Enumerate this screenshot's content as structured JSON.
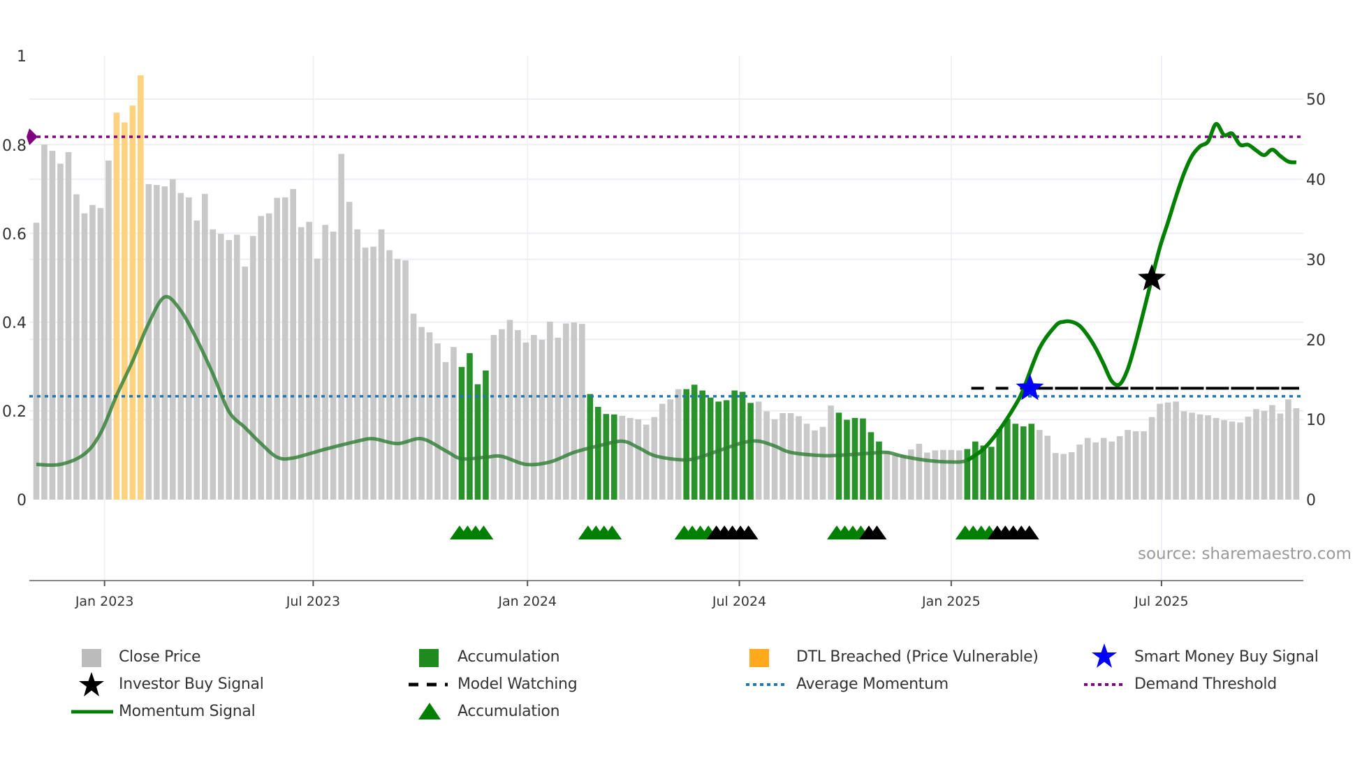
{
  "chart_data": {
    "type": "bar",
    "title": "",
    "source": "source: sharemaestro.com",
    "left_axis": {
      "ticks": [
        "0",
        "0.2",
        "0.4",
        "0.6",
        "0.8",
        "1"
      ],
      "tick_values": [
        0,
        0.2,
        0.4,
        0.6,
        0.8,
        1
      ],
      "range": [
        0,
        1
      ]
    },
    "right_axis": {
      "ticks": [
        "0",
        "10",
        "20",
        "30",
        "40",
        "50"
      ],
      "tick_values": [
        0,
        10,
        20,
        30,
        40,
        50
      ],
      "range": [
        0,
        50
      ]
    },
    "x_ticks": [
      {
        "label": "Jan 2023",
        "week": 8.5
      },
      {
        "label": "Jul 2023",
        "week": 34.5
      },
      {
        "label": "Jan 2024",
        "week": 61.2
      },
      {
        "label": "Jul 2024",
        "week": 87.6
      },
      {
        "label": "Jan 2025",
        "week": 114
      },
      {
        "label": "Jul 2025",
        "week": 140.2
      }
    ],
    "close_price": [
      0.624,
      0.8,
      0.786,
      0.757,
      0.783,
      0.688,
      0.645,
      0.664,
      0.657,
      0.764,
      0.872,
      0.85,
      0.888,
      0.956,
      0.711,
      0.709,
      0.706,
      0.722,
      0.691,
      0.681,
      0.629,
      0.689,
      0.609,
      0.599,
      0.585,
      0.597,
      0.525,
      0.594,
      0.639,
      0.645,
      0.68,
      0.681,
      0.7,
      0.614,
      0.626,
      0.543,
      0.619,
      0.604,
      0.779,
      0.671,
      0.609,
      0.568,
      0.57,
      0.609,
      0.562,
      0.542,
      0.539,
      0.419,
      0.389,
      0.377,
      0.352,
      0.31,
      0.344,
      0.299,
      0.33,
      0.26,
      0.291,
      0.371,
      0.384,
      0.405,
      0.382,
      0.354,
      0.371,
      0.36,
      0.401,
      0.365,
      0.397,
      0.399,
      0.396,
      0.238,
      0.209,
      0.193,
      0.192,
      0.189,
      0.184,
      0.181,
      0.169,
      0.186,
      0.216,
      0.226,
      0.249,
      0.249,
      0.259,
      0.246,
      0.23,
      0.221,
      0.224,
      0.246,
      0.243,
      0.218,
      0.221,
      0.199,
      0.181,
      0.195,
      0.195,
      0.188,
      0.171,
      0.156,
      0.164,
      0.212,
      0.196,
      0.18,
      0.184,
      0.183,
      0.152,
      0.131,
      0.109,
      0.101,
      0.101,
      0.113,
      0.126,
      0.106,
      0.111,
      0.112,
      0.112,
      0.111,
      0.114,
      0.131,
      0.122,
      0.119,
      0.159,
      0.182,
      0.171,
      0.165,
      0.171,
      0.157,
      0.144,
      0.105,
      0.103,
      0.107,
      0.124,
      0.139,
      0.129,
      0.139,
      0.131,
      0.143,
      0.157,
      0.154,
      0.154,
      0.186,
      0.216,
      0.219,
      0.221,
      0.199,
      0.196,
      0.192,
      0.19,
      0.184,
      0.179,
      0.176,
      0.174,
      0.187,
      0.204,
      0.2,
      0.213,
      0.194,
      0.226,
      0.206
    ],
    "accumulation_ranges": [
      [
        53,
        56
      ],
      [
        69,
        72
      ],
      [
        81,
        89
      ],
      [
        100,
        105
      ],
      [
        116,
        124
      ]
    ],
    "dtl_breached_ranges": [
      [
        10,
        13
      ]
    ],
    "momentum_signal": [
      [
        0,
        4.4
      ],
      [
        3,
        4.4
      ],
      [
        6,
        5.7
      ],
      [
        8,
        8.3
      ],
      [
        10,
        13
      ],
      [
        12,
        17.3
      ],
      [
        14,
        22
      ],
      [
        16,
        25.3
      ],
      [
        18,
        23.6
      ],
      [
        20,
        20
      ],
      [
        22,
        15.7
      ],
      [
        24,
        11
      ],
      [
        26,
        9
      ],
      [
        28,
        7
      ],
      [
        30,
        5.3
      ],
      [
        32,
        5.2
      ],
      [
        36,
        6.3
      ],
      [
        40,
        7.3
      ],
      [
        42,
        7.6
      ],
      [
        45,
        7
      ],
      [
        48,
        7.6
      ],
      [
        51,
        6.1
      ],
      [
        53,
        5.1
      ],
      [
        56,
        5.3
      ],
      [
        58,
        5.4
      ],
      [
        61,
        4.4
      ],
      [
        64,
        4.7
      ],
      [
        67,
        5.9
      ],
      [
        70,
        6.7
      ],
      [
        73,
        7.3
      ],
      [
        75,
        6.5
      ],
      [
        77,
        5.5
      ],
      [
        80,
        5.0
      ],
      [
        82,
        5.1
      ],
      [
        85,
        6.1
      ],
      [
        88,
        7.1
      ],
      [
        90,
        7.3
      ],
      [
        92,
        6.7
      ],
      [
        94,
        5.9
      ],
      [
        98,
        5.5
      ],
      [
        101,
        5.6
      ],
      [
        104,
        5.8
      ],
      [
        106,
        5.9
      ],
      [
        108,
        5.4
      ],
      [
        111,
        4.9
      ],
      [
        114,
        4.7
      ],
      [
        116,
        4.9
      ],
      [
        118,
        6.3
      ],
      [
        120,
        8.7
      ],
      [
        122,
        11.8
      ],
      [
        123,
        13.8
      ],
      [
        125,
        18.9
      ],
      [
        127,
        21.7
      ],
      [
        128,
        22.2
      ],
      [
        129,
        22.2
      ],
      [
        130,
        21.7
      ],
      [
        131,
        20.5
      ],
      [
        132,
        18.9
      ],
      [
        133,
        16.9
      ],
      [
        134,
        14.8
      ],
      [
        135,
        14.4
      ],
      [
        136,
        16.3
      ],
      [
        137,
        19.7
      ],
      [
        138,
        23.6
      ],
      [
        139,
        27.6
      ],
      [
        140,
        31.5
      ],
      [
        141,
        34.6
      ],
      [
        142,
        37.8
      ],
      [
        143,
        40.7
      ],
      [
        144,
        42.9
      ],
      [
        145,
        44.1
      ],
      [
        146,
        44.7
      ],
      [
        147,
        46.9
      ],
      [
        148,
        45.5
      ],
      [
        149,
        45.7
      ],
      [
        150,
        44.3
      ],
      [
        151,
        44.3
      ],
      [
        152,
        43.6
      ],
      [
        153,
        43.0
      ],
      [
        154,
        43.7
      ],
      [
        155,
        42.9
      ],
      [
        156,
        42.2
      ],
      [
        157,
        42.1
      ]
    ],
    "momentum_faded_until_week": 118,
    "average_momentum": 12.9,
    "demand_threshold": 45.3,
    "model_watching": {
      "value": 13.9,
      "from_week": 116.5,
      "to_week": 157
    },
    "smart_money_buy_signal": {
      "week": 123.8,
      "value": 13.9
    },
    "investor_buy_signal": {
      "week": 139,
      "value": 27.6
    },
    "accumulation_markers_green": [
      53,
      54,
      55,
      56,
      69,
      70,
      71,
      72,
      81,
      82,
      83,
      84,
      100,
      101,
      102,
      103,
      116,
      117,
      118,
      119
    ],
    "accumulation_markers_black": [
      85,
      86,
      87,
      88,
      89,
      104,
      105,
      120,
      121,
      122,
      123,
      124
    ],
    "colors": {
      "close": "#c8c8c8",
      "accumulation": "#2a922a",
      "dtl": "#ffd27f",
      "momentum": "#008000",
      "avg": "#1f77b4",
      "demand": "#800080",
      "watch": "#000000",
      "smart": "#0000ff"
    },
    "legend": [
      {
        "label": "Close Price",
        "icon": "gray-square"
      },
      {
        "label": "Accumulation",
        "icon": "green-square"
      },
      {
        "label": "DTL Breached (Price Vulnerable)",
        "icon": "orange-square"
      },
      {
        "label": "Smart Money Buy Signal",
        "icon": "blue-star"
      },
      {
        "label": "Investor Buy Signal",
        "icon": "black-star"
      },
      {
        "label": "Model Watching",
        "icon": "black-dashed-line"
      },
      {
        "label": "Average Momentum",
        "icon": "blue-dotted-line"
      },
      {
        "label": "Demand Threshold",
        "icon": "purple-dotted-line"
      },
      {
        "label": "Momentum Signal",
        "icon": "green-line"
      },
      {
        "label": "Accumulation",
        "icon": "green-triangle"
      }
    ],
    "legend_placement": "bottom"
  }
}
